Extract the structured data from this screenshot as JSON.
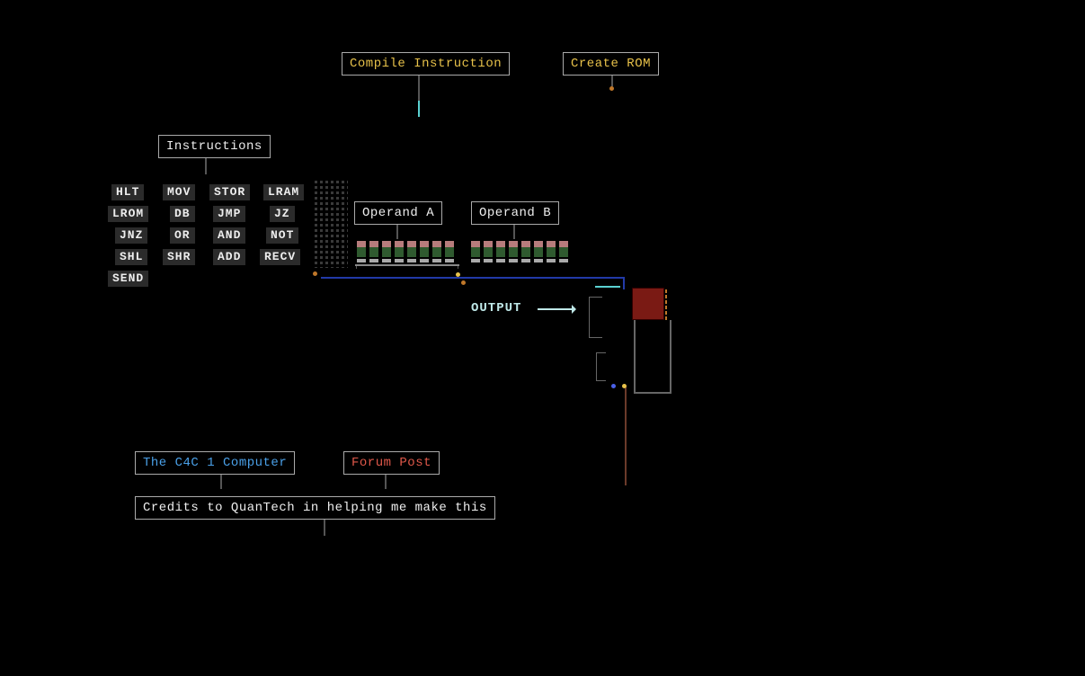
{
  "actions": {
    "compile": "Compile Instruction",
    "create_rom": "Create ROM"
  },
  "panels": {
    "instructions_title": "Instructions",
    "operand_a": "Operand A",
    "operand_b": "Operand B",
    "output": "OUTPUT"
  },
  "instructions": [
    "HLT",
    "MOV",
    "STOR",
    "LRAM",
    "LROM",
    "DB",
    "JMP",
    "JZ",
    "JNZ",
    "OR",
    "AND",
    "NOT",
    "SHL",
    "SHR",
    "ADD",
    "RECV",
    "SEND"
  ],
  "operand_bits": {
    "a": 8,
    "b": 8
  },
  "footer": {
    "title": "The C4C 1 Computer",
    "forum": "Forum Post",
    "credits": "Credits to QuanTech in helping me make this"
  }
}
